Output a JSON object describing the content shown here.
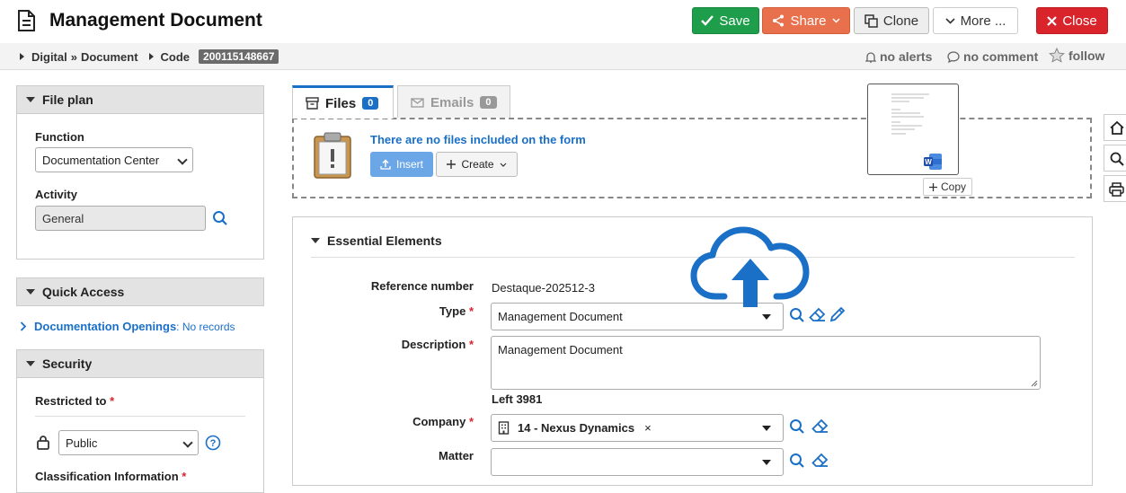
{
  "header": {
    "title": "Management Document",
    "save_label": "Save",
    "share_label": "Share",
    "clone_label": "Clone",
    "more_label": "More ...",
    "close_label": "Close"
  },
  "breadcrumb": {
    "items": [
      "Digital",
      "Document",
      "Code"
    ],
    "separator": "»",
    "code": "200115148667",
    "alerts": "no alerts",
    "comments": "no comment",
    "follow": "follow"
  },
  "left": {
    "file_plan": {
      "title": "File plan",
      "function_label": "Function",
      "function_value": "Documentation Center",
      "activity_label": "Activity",
      "activity_value": "General"
    },
    "quick_access": {
      "title": "Quick Access",
      "link": "Documentation Openings",
      "link_suffix": ": No records"
    },
    "security": {
      "title": "Security",
      "restricted_label": "Restricted to",
      "restricted_value": "Public",
      "classification_label": "Classification Information"
    }
  },
  "files": {
    "tab_files": "Files",
    "files_count": "0",
    "tab_emails": "Emails",
    "emails_count": "0",
    "empty_message": "There are no files included on the form",
    "insert_label": "Insert",
    "create_label": "Create",
    "copy_label": "Copy"
  },
  "essential": {
    "title": "Essential Elements",
    "reference_label": "Reference number",
    "reference_value": "Destaque-202512-3",
    "type_label": "Type",
    "type_value": "Management Document",
    "description_label": "Description",
    "description_value": "Management Document",
    "left_label": "Left 3981",
    "company_label": "Company",
    "company_value": "14 - Nexus Dynamics",
    "company_remove": "×",
    "matter_label": "Matter"
  },
  "colors": {
    "accent": "#1a6fc7",
    "save": "#1e9e4a",
    "share": "#e8704c",
    "close": "#d9242c"
  }
}
